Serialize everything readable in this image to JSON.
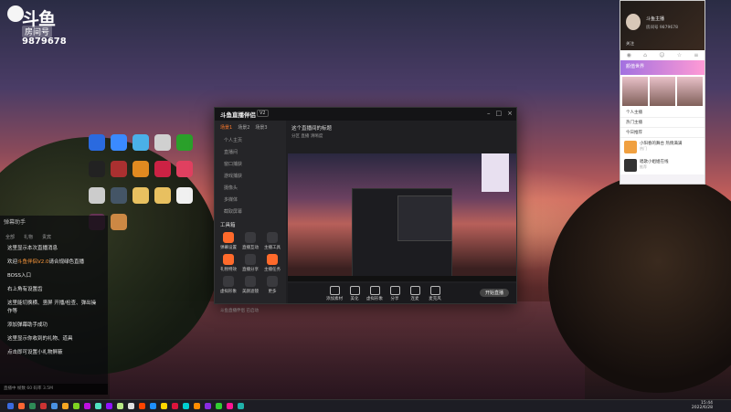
{
  "douyu": {
    "logo_text": "斗鱼",
    "room_tag": "房间号",
    "room_number": "9879678"
  },
  "desktop_icons": [
    {
      "name": "qq-music",
      "color": "#2a6adf"
    },
    {
      "name": "qq-browser",
      "color": "#3a8aff"
    },
    {
      "name": "app-3",
      "color": "#4ab0e8"
    },
    {
      "name": "app-4",
      "color": "#d0d0d0"
    },
    {
      "name": "app-5",
      "color": "#2aa02a"
    },
    {
      "name": "obs",
      "color": "#222"
    },
    {
      "name": "game-1",
      "color": "#aa3030"
    },
    {
      "name": "app-8",
      "color": "#e08a20"
    },
    {
      "name": "app-9",
      "color": "#cc2244"
    },
    {
      "name": "app-10",
      "color": "#e04060"
    },
    {
      "name": "app-11",
      "color": "#ccc"
    },
    {
      "name": "app-12",
      "color": "#445566"
    },
    {
      "name": "folder-1",
      "color": "#e8c060"
    },
    {
      "name": "folder-2",
      "color": "#e8c060"
    },
    {
      "name": "app-15",
      "color": "#f0f0f0"
    },
    {
      "name": "app-16",
      "color": "#663355"
    },
    {
      "name": "app-17",
      "color": "#cc8844"
    }
  ],
  "chat": {
    "header": "弹幕助手",
    "tabs": [
      "全部",
      "礼物",
      "贵宾"
    ],
    "messages": [
      {
        "text": "这里显示本次直播消息"
      },
      {
        "prefix": "欢迎",
        "highlight": "斗鱼伴侣V2.0",
        "text": "请合规绿色直播"
      },
      {
        "text": "BOSS入口"
      },
      {
        "text": "右上角有设置齿"
      },
      {
        "text": "这里能切换横、竖屏 开播/检查、弹出操作等"
      },
      {
        "text": "添加弹幕助手成功"
      },
      {
        "text": "这里显示你收到的礼物、道具"
      },
      {
        "text": "点击即可设置小礼物屏蔽"
      }
    ],
    "footer": "直播中 帧数 60 码率 3.5M"
  },
  "app": {
    "brand": "斗鱼直播伴侣",
    "version": "V2",
    "side_tabs": [
      "场景1",
      "场景2",
      "场景3"
    ],
    "scenes": [
      "个人主页",
      "直播间",
      "窗口捕获",
      "游戏捕获",
      "摄像头",
      "多媒体",
      "截取屏幕"
    ],
    "tools_title": "工具箱",
    "tools": [
      {
        "label": "弹幕设置",
        "orange": true
      },
      {
        "label": "直播互动",
        "orange": false
      },
      {
        "label": "主播工具",
        "orange": false
      },
      {
        "label": "礼物特效",
        "orange": true
      },
      {
        "label": "直播分享",
        "orange": false
      },
      {
        "label": "主播任务",
        "orange": true
      },
      {
        "label": "虚拟形象",
        "orange": false
      },
      {
        "label": "美颜滤镜",
        "orange": false
      },
      {
        "label": "更多",
        "orange": false
      }
    ],
    "top_info": "这个直播间的标题",
    "sub_info": "分区 直播 清晰度",
    "bottom_items": [
      "添加素材",
      "美化",
      "虚拟形象",
      "分享",
      "连麦",
      "麦克风"
    ],
    "golive": "开始直播",
    "status": "斗鱼直播伴侣 已启动"
  },
  "right_panel": {
    "name": "斗鱼主播",
    "sub": "房间号 9879678",
    "follow": "关注",
    "nav": [
      "◉",
      "⌂",
      "☺",
      "☆",
      "≡"
    ],
    "banner": "颜值世界",
    "list": [
      "个人主播",
      "热门主播",
      "今日推荐"
    ],
    "cards": [
      {
        "title": "小阳春的舞台 热情满满",
        "sub": "热门",
        "dark": false
      },
      {
        "title": "唱歌小姐姐在线",
        "sub": "推荐",
        "dark": true
      }
    ]
  },
  "taskbar": {
    "icons": [
      "#3a6adf",
      "#ff6633",
      "#2e8b57",
      "#cc3333",
      "#4a90e2",
      "#f5a623",
      "#7ed321",
      "#bd10e0",
      "#50e3c2",
      "#9013fe",
      "#b8e986",
      "#e0e0e0",
      "#ff4500",
      "#1e90ff",
      "#ffd700",
      "#dc143c",
      "#00ced1",
      "#ff8c00",
      "#8a2be2",
      "#32cd32",
      "#ff1493",
      "#20b2aa"
    ],
    "time": "15:44",
    "date": "2022/6/28"
  },
  "colors": {
    "accent": "#ff6a2b"
  }
}
